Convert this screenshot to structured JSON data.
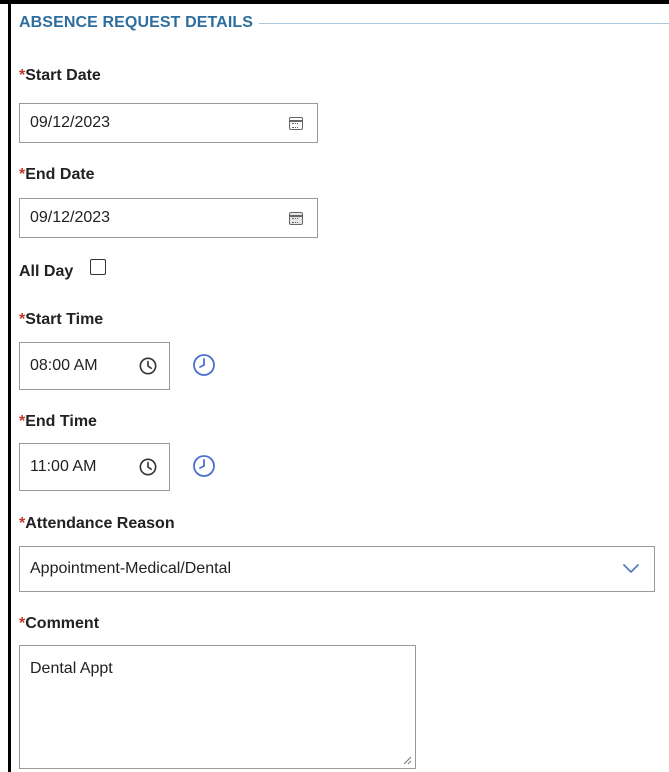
{
  "section": {
    "title": "ABSENCE REQUEST DETAILS"
  },
  "required_marker": "*",
  "fields": {
    "start_date": {
      "label": "Start Date",
      "value": "09/12/2023"
    },
    "end_date": {
      "label": "End Date",
      "value": "09/12/2023"
    },
    "all_day": {
      "label": "All Day",
      "checked": false
    },
    "start_time": {
      "label": "Start Time",
      "value": "08:00 AM"
    },
    "end_time": {
      "label": "End Time",
      "value": "11:00 AM"
    },
    "attendance_reason": {
      "label": "Attendance Reason",
      "value": "Appointment-Medical/Dental"
    },
    "comment": {
      "label": "Comment",
      "value": "Dental Appt"
    }
  },
  "icons": {
    "date_picker": "calendar-icon",
    "time_picker": "clock-icon",
    "time_popup": "clock-icon",
    "dropdown": "chevron-down-icon"
  },
  "colors": {
    "header": "#2e6e9e",
    "required": "#c0392b",
    "clock_accent": "#4a6fd1"
  }
}
